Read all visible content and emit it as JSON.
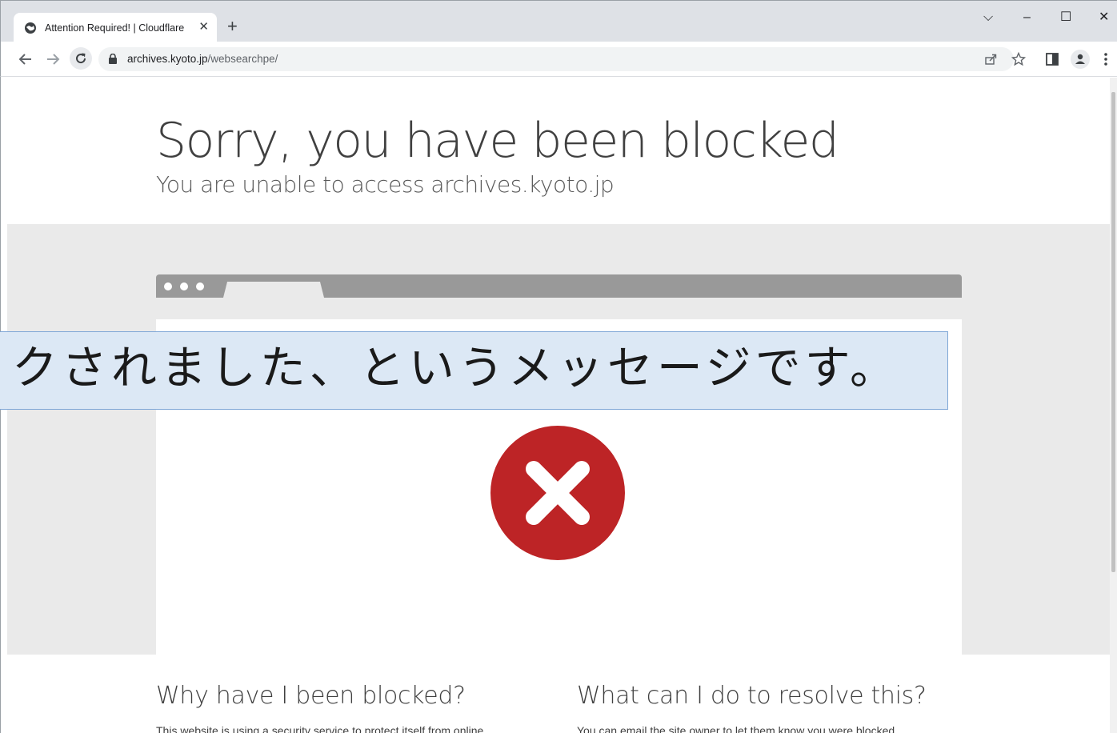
{
  "browser": {
    "tab": {
      "title": "Attention Required! | Cloudflare",
      "close": "✕"
    },
    "new_tab": "+",
    "window_controls": {
      "dropdown": "⌵",
      "minimize": "–",
      "maximize": "☐",
      "close": "✕"
    },
    "address_bar": {
      "host": "archives.kyoto.jp",
      "path": "/websearchpe/"
    }
  },
  "page": {
    "title": "Sorry, you have been blocked",
    "subtitle": "You are unable to access archives.kyoto.jp",
    "why_heading": "Why have I been blocked?",
    "why_text": "This website is using a security service to protect itself from online",
    "resolve_heading": "What can I do to resolve this?",
    "resolve_text": "You can email the site owner to let them know you were blocked."
  },
  "caption": {
    "text": "クされました、というメッセージです。"
  },
  "colors": {
    "error_red": "#bd2426",
    "band_gray": "#eaeaea",
    "mock_bar": "#999999",
    "caption_bg": "#dce8f5"
  }
}
